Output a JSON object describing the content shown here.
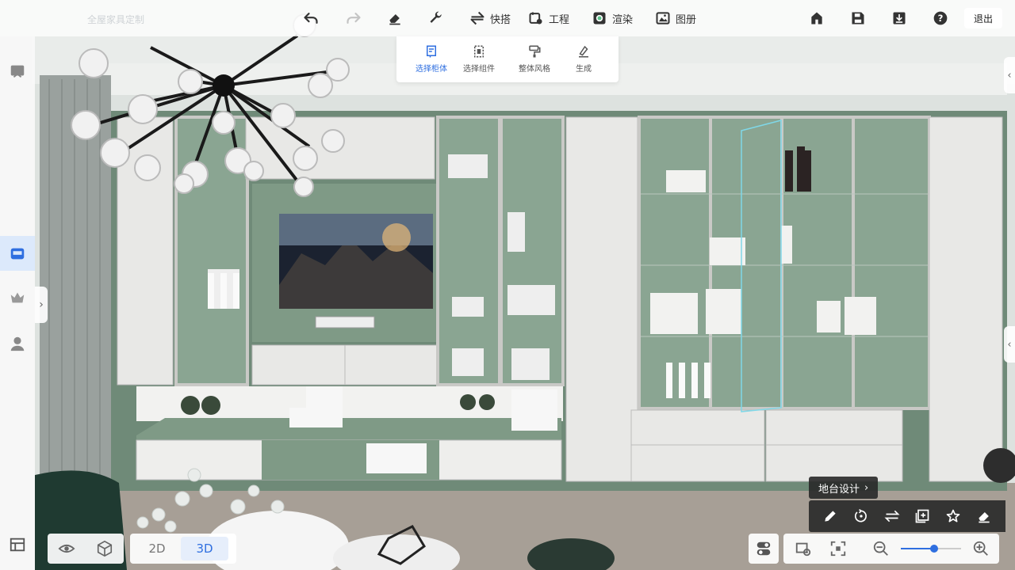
{
  "toolbar": {
    "brand": "全屋家具定制",
    "buttons": [
      {
        "id": "undo",
        "icon": "undo-icon",
        "label": ""
      },
      {
        "id": "redo",
        "icon": "redo-icon",
        "label": ""
      },
      {
        "id": "eraser",
        "icon": "eraser-icon",
        "label": ""
      },
      {
        "id": "wrench",
        "icon": "wrench-icon",
        "label": ""
      },
      {
        "id": "quick",
        "icon": "lightning-icon",
        "label": "快搭"
      },
      {
        "id": "project",
        "icon": "project-icon",
        "label": "工程"
      },
      {
        "id": "render",
        "icon": "render-icon",
        "label": "渲染"
      },
      {
        "id": "album",
        "icon": "album-icon",
        "label": "图册"
      }
    ],
    "right_icons": [
      "home-icon",
      "save-icon",
      "download-icon",
      "help-icon"
    ],
    "exit_label": "退出"
  },
  "submenu": {
    "items": [
      {
        "label": "选择柜体",
        "icon": "select-cabinet-icon",
        "active": true
      },
      {
        "label": "选择组件",
        "icon": "select-component-icon",
        "active": false
      },
      {
        "label": "整体风格",
        "icon": "style-roller-icon",
        "active": false
      },
      {
        "label": "生成",
        "icon": "generate-icon",
        "active": false
      }
    ]
  },
  "sidebar": {
    "items": [
      {
        "icon": "catalog-icon",
        "active": false
      },
      {
        "icon": "cabinet-icon",
        "active": true
      },
      {
        "icon": "crown-icon",
        "active": false
      },
      {
        "icon": "user-icon",
        "active": false
      }
    ],
    "bottom_icon": "layers-icon"
  },
  "view_controls": {
    "eye_icon": "eye-icon",
    "cube_icon": "cube-icon",
    "mode_2d": "2D",
    "mode_3d": "3D",
    "active_mode": "3D"
  },
  "context_panel": {
    "title": "地台设计",
    "tools": [
      "pencil-icon",
      "rotate-icon",
      "swap-icon",
      "add-copy-icon",
      "star-icon",
      "eraser-icon"
    ]
  },
  "zoom": {
    "icons": [
      "settings-view-icon",
      "fit-view-icon",
      "zoom-out-icon",
      "zoom-in-icon"
    ],
    "level": 0.55
  },
  "colors": {
    "accent": "#2f6fe0",
    "cabinet_green": "#7f9a86",
    "cabinet_white": "#e8e8e6",
    "floor": "#a79f96"
  }
}
